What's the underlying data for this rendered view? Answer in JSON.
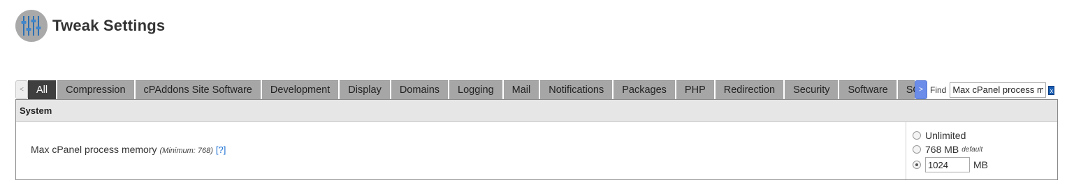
{
  "page": {
    "title": "Tweak Settings",
    "icon": "sliders-icon"
  },
  "tabs": {
    "scroll_left": "<",
    "scroll_right": ">",
    "items": [
      "All",
      "Compression",
      "cPAddons Site Software",
      "Development",
      "Display",
      "Domains",
      "Logging",
      "Mail",
      "Notifications",
      "Packages",
      "PHP",
      "Redirection",
      "Security",
      "Software",
      "SQL"
    ],
    "active": "All"
  },
  "find": {
    "label": "Find",
    "value": "Max cPanel process memory",
    "clear_label": "x"
  },
  "section": {
    "title": "System"
  },
  "setting": {
    "label": "Max cPanel process memory",
    "minimum": "(Minimum: 768)",
    "help": "[?]",
    "options": {
      "unlimited": "Unlimited",
      "default_value": "768 MB",
      "default_tag": "default",
      "custom_value": "1024",
      "custom_unit": "MB"
    },
    "selected": "custom"
  },
  "colors": {
    "active_tab": "#3f3f3f",
    "inactive_tab": "#a6a6a6",
    "scroll_right": "#6b8ce8",
    "help_link": "#1a6fd1"
  }
}
